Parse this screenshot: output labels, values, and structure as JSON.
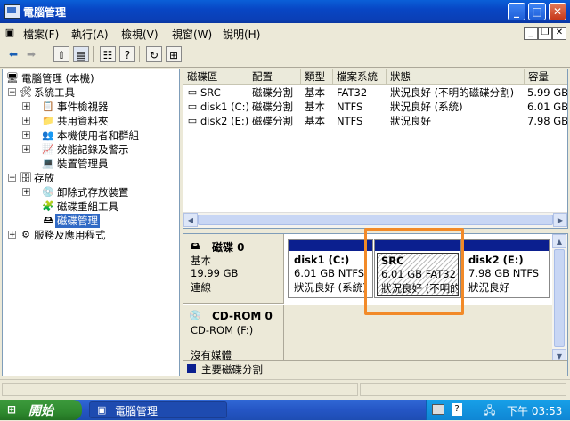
{
  "window": {
    "title": "電腦管理"
  },
  "menu": [
    "檔案(F)",
    "執行(A)",
    "檢視(V)",
    "視窗(W)",
    "說明(H)"
  ],
  "tree": {
    "root": "電腦管理 (本機)",
    "system_tools": "系統工具",
    "event_viewer": "事件檢視器",
    "shared_folders": "共用資料夾",
    "local_users": "本機使用者和群組",
    "perf_logs": "效能記錄及警示",
    "device_manager": "裝置管理員",
    "storage": "存放",
    "removable": "卸除式存放裝置",
    "defrag": "磁碟重組工具",
    "disk_mgmt": "磁碟管理",
    "services": "服務及應用程式"
  },
  "list": {
    "headers": [
      "磁碟區",
      "配置",
      "類型",
      "檔案系統",
      "狀態",
      "容量"
    ],
    "rows": [
      [
        "SRC",
        "磁碟分割",
        "基本",
        "FAT32",
        "狀況良好 (不明的磁碟分割)",
        "5.99 GB"
      ],
      [
        "disk1 (C:)",
        "磁碟分割",
        "基本",
        "NTFS",
        "狀況良好 (系統)",
        "6.01 GB"
      ],
      [
        "disk2 (E:)",
        "磁碟分割",
        "基本",
        "NTFS",
        "狀況良好",
        "7.98 GB"
      ]
    ]
  },
  "disk0": {
    "name": "磁碟 0",
    "type": "基本",
    "size": "19.99 GB",
    "status": "連線",
    "partitions": [
      {
        "name": "disk1  (C:)",
        "info": "6.01 GB NTFS",
        "status": "狀況良好 (系統)"
      },
      {
        "name": "SRC",
        "info": "6.01 GB FAT32",
        "status": "狀況良好 (不明的磁碟分割)"
      },
      {
        "name": "disk2  (E:)",
        "info": "7.98 GB NTFS",
        "status": "狀況良好"
      }
    ]
  },
  "cdrom": {
    "name": "CD-ROM 0",
    "drive": "CD-ROM (F:)",
    "media": "沒有媒體"
  },
  "legend": {
    "primary": "主要磁碟分割",
    "primary_color": "#0b1f8f"
  },
  "taskbar": {
    "start": "開始",
    "task": "電腦管理",
    "clock": "下午 03:53"
  },
  "colors": {
    "titlebar": "#0a5fd8",
    "selection": "#316ac5",
    "highlight_box": "#f28a28"
  }
}
